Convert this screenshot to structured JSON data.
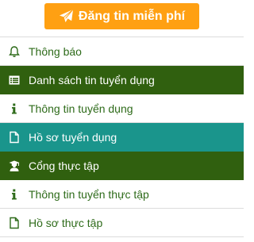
{
  "post_button": {
    "label": "Đăng tin miễn phí",
    "icon": "paper-plane-icon",
    "color": "#ffa012"
  },
  "menu": {
    "items": [
      {
        "label": "Thông báo",
        "icon": "bell-icon",
        "state": "default"
      },
      {
        "label": "Danh sách tin tuyển dụng",
        "icon": "list-alt-icon",
        "state": "active-dark"
      },
      {
        "label": "Thông tin tuyển dụng",
        "icon": "info-icon",
        "state": "default"
      },
      {
        "label": "Hồ sơ tuyển dụng",
        "icon": "file-icon",
        "state": "active-teal"
      },
      {
        "label": "Cổng thực tập",
        "icon": "graduate-icon",
        "state": "active-dark"
      },
      {
        "label": "Thông tin tuyển thực tập",
        "icon": "info-icon",
        "state": "default"
      },
      {
        "label": "Hồ sơ thực tập",
        "icon": "file-icon",
        "state": "default"
      }
    ]
  },
  "colors": {
    "text_green": "#2e6b1a",
    "active_dark": "#30600f",
    "active_teal": "#1a958c"
  }
}
